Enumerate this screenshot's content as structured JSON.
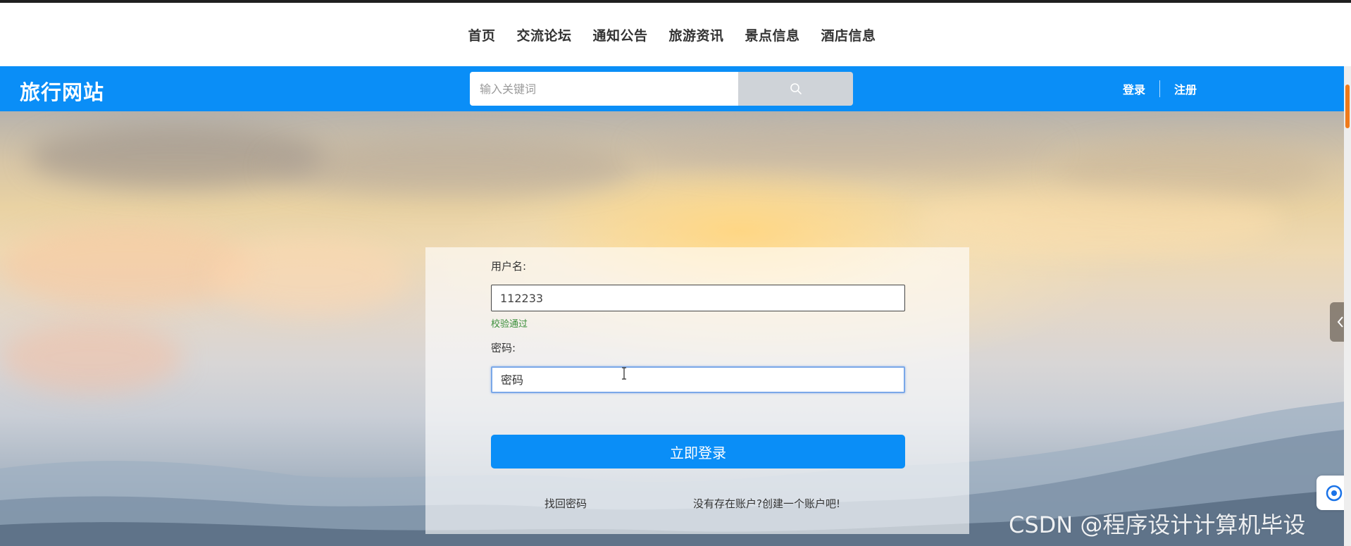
{
  "nav": {
    "items": [
      "首页",
      "交流论坛",
      "通知公告",
      "旅游资讯",
      "景点信息",
      "酒店信息"
    ]
  },
  "header": {
    "brand": "旅行网站",
    "search_placeholder": "输入关键词",
    "login_label": "登录",
    "register_label": "注册",
    "accent_color": "#0a8ef7"
  },
  "login_form": {
    "username_label": "用户名:",
    "username_value": "112233",
    "username_status": "校验通过",
    "password_label": "密码:",
    "password_placeholder": "密码",
    "submit_label": "立即登录",
    "forgot_label": "找回密码",
    "signup_prompt": "没有存在账户?创建一个账户吧!"
  },
  "watermark": "CSDN @程序设计计算机毕设"
}
